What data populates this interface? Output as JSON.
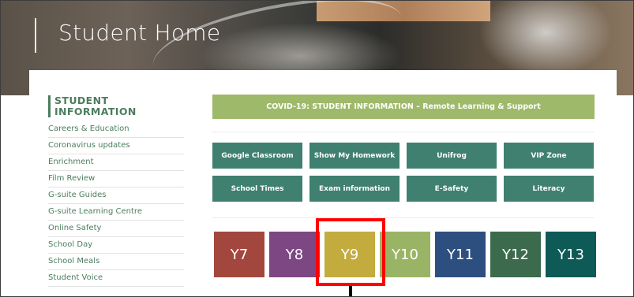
{
  "page": {
    "title": "Student Home"
  },
  "sidebar": {
    "heading": "STUDENT INFORMATION",
    "items": [
      {
        "label": "Careers & Education"
      },
      {
        "label": "Coronavirus updates"
      },
      {
        "label": "Enrichment"
      },
      {
        "label": "Film Review"
      },
      {
        "label": "G-suite Guides"
      },
      {
        "label": "G-suite Learning Centre"
      },
      {
        "label": "Online Safety"
      },
      {
        "label": "School Day"
      },
      {
        "label": "School Meals"
      },
      {
        "label": "Student Voice"
      }
    ]
  },
  "banner": {
    "label": "COVID-19: STUDENT INFORMATION – Remote Learning & Support"
  },
  "quick_links": [
    {
      "label": "Google Classroom"
    },
    {
      "label": "Show My Homework"
    },
    {
      "label": "Unifrog"
    },
    {
      "label": "VIP Zone"
    },
    {
      "label": "School Times"
    },
    {
      "label": "Exam information"
    },
    {
      "label": "E-Safety"
    },
    {
      "label": "Literacy"
    }
  ],
  "year_groups": [
    {
      "label": "Y7",
      "color": "#a3463e"
    },
    {
      "label": "Y8",
      "color": "#7c4783"
    },
    {
      "label": "Y9",
      "color": "#c3ab3e"
    },
    {
      "label": "Y10",
      "color": "#9ab466"
    },
    {
      "label": "Y11",
      "color": "#2d4f80"
    },
    {
      "label": "Y12",
      "color": "#3b6b4c"
    },
    {
      "label": "Y13",
      "color": "#0d5a57"
    }
  ],
  "colors": {
    "accent_green": "#4b7d5f",
    "button_teal": "#3f8070",
    "banner_green": "#9fb96a",
    "highlight_red": "#ff0000"
  }
}
